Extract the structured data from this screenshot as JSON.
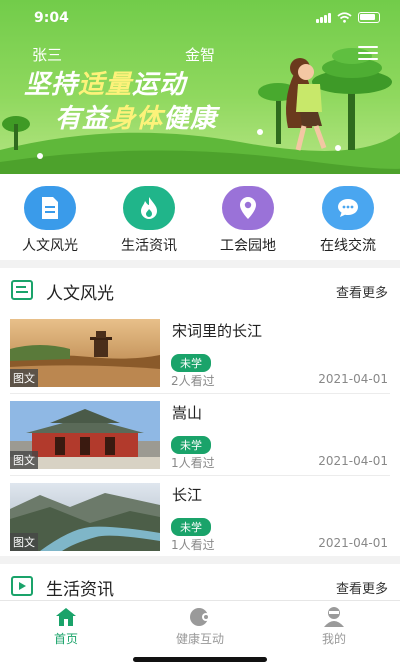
{
  "status": {
    "time": "9:04"
  },
  "header": {
    "user_name": "张三",
    "title": "金智"
  },
  "banner": {
    "line1": "坚持适量运动",
    "line2": "有益身体健康"
  },
  "quicknav": [
    {
      "label": "人文风光",
      "icon": "document-icon",
      "color": "#3a9bea"
    },
    {
      "label": "生活资讯",
      "icon": "fire-icon",
      "color": "#20b58a"
    },
    {
      "label": "工会园地",
      "icon": "location-pin-icon",
      "color": "#9a72d8"
    },
    {
      "label": "在线交流",
      "icon": "chat-bubble-icon",
      "color": "#4aa6f0"
    }
  ],
  "sections": {
    "culture": {
      "title": "人文风光",
      "more": "查看更多",
      "articles": [
        {
          "title": "宋词里的长江",
          "badge": "未学",
          "views": "2人看过",
          "date": "2021-04-01",
          "tag": "图文"
        },
        {
          "title": "嵩山",
          "badge": "未学",
          "views": "1人看过",
          "date": "2021-04-01",
          "tag": "图文"
        },
        {
          "title": "长江",
          "badge": "未学",
          "views": "1人看过",
          "date": "2021-04-01",
          "tag": "图文"
        }
      ]
    },
    "life": {
      "title": "生活资讯",
      "more": "查看更多"
    }
  },
  "tabbar": [
    {
      "label": "首页",
      "icon": "home-icon",
      "active": true
    },
    {
      "label": "健康互动",
      "icon": "health-icon",
      "active": false
    },
    {
      "label": "我的",
      "icon": "profile-icon",
      "active": false
    }
  ],
  "colors": {
    "primary": "#1aa36a",
    "banner_green": "#7ccf52"
  }
}
